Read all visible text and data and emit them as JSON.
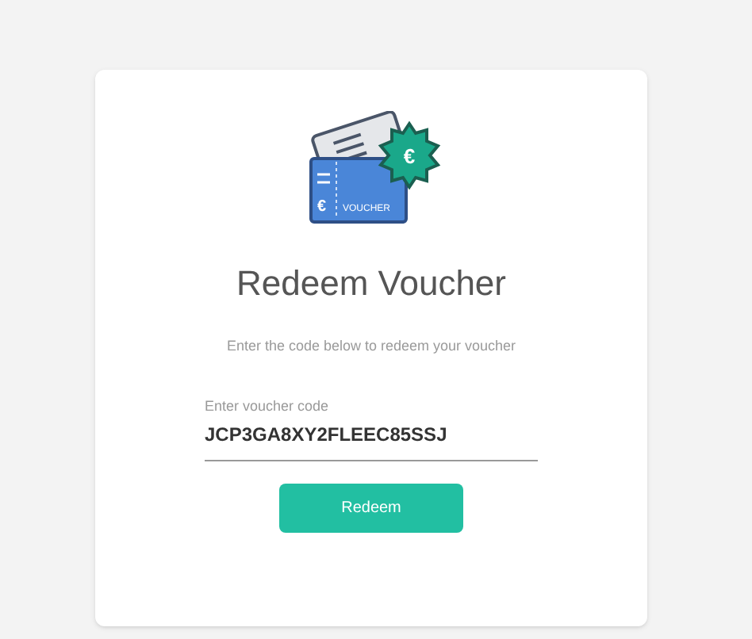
{
  "illustration": {
    "badge_symbol": "€",
    "card_symbol": "€",
    "card_label": "VOUCHER"
  },
  "title": "Redeem Voucher",
  "subtitle": "Enter the code below to redeem your voucher",
  "code_field": {
    "label": "Enter voucher code",
    "value": "JCP3GA8XY2FLEEC85SSJ"
  },
  "button": "Redeem"
}
